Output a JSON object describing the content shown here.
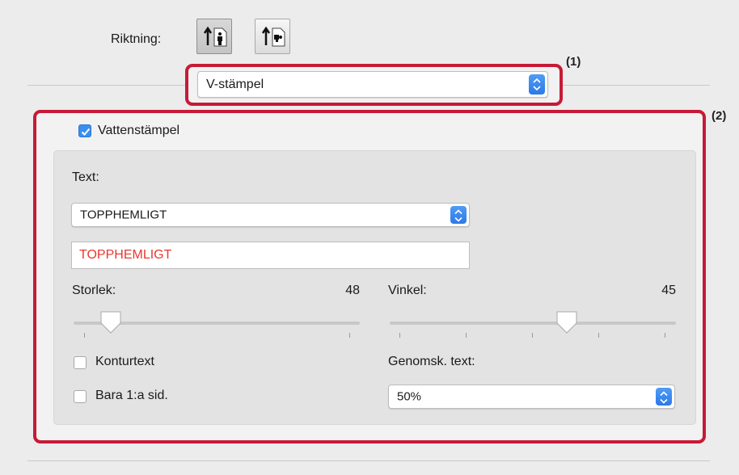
{
  "orientation": {
    "label": "Riktning:",
    "options": [
      {
        "icon": "portrait-orientation-icon",
        "selected": true
      },
      {
        "icon": "landscape-orientation-icon",
        "selected": false
      }
    ]
  },
  "menu": {
    "value": "V-stämpel",
    "callout": "(1)"
  },
  "watermark": {
    "callout": "(2)",
    "checkbox": {
      "label": "Vattenstämpel",
      "checked": true
    },
    "text_label": "Text:",
    "text_select": "TOPPHEMLIGT",
    "text_field": "TOPPHEMLIGT",
    "size": {
      "label": "Storlek:",
      "value": "48",
      "fraction": 0.13
    },
    "angle": {
      "label": "Vinkel:",
      "value": "45",
      "fraction": 0.62
    },
    "outline": {
      "label": "Konturtext",
      "checked": false
    },
    "first_page": {
      "label": "Bara 1:a sid.",
      "checked": false
    },
    "transparency": {
      "label": "Genomsk. text:",
      "value": "50%"
    }
  },
  "colors": {
    "callout": "#c61a36",
    "accent": "#3b8eef",
    "watermark_text": "#e8382f"
  }
}
